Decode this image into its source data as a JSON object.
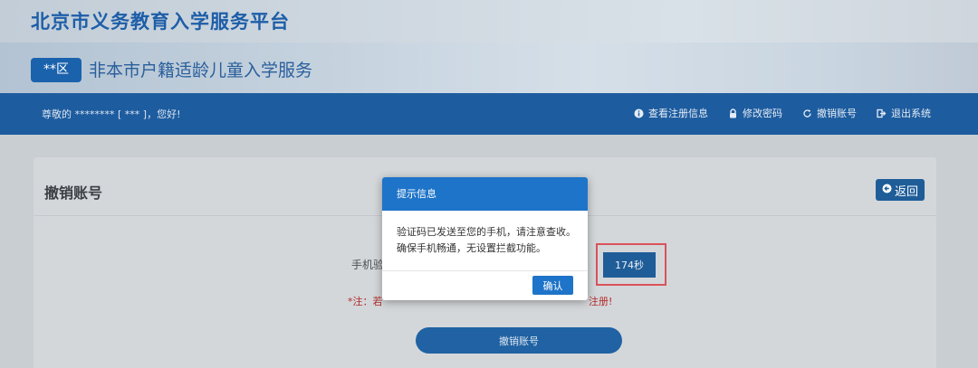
{
  "platform": {
    "title": "北京市义务教育入学服务平台"
  },
  "banner": {
    "district": "**区",
    "title": "非本市户籍适龄儿童入学服务"
  },
  "navbar": {
    "greeting": "尊敬的 ******** [ *** ]，您好!",
    "links": [
      {
        "label": "查看注册信息",
        "icon": "info-icon"
      },
      {
        "label": "修改密码",
        "icon": "lock-icon"
      },
      {
        "label": "撤销账号",
        "icon": "refresh-icon"
      },
      {
        "label": "退出系统",
        "icon": "logout-icon"
      }
    ]
  },
  "page": {
    "title": "撤销账号",
    "back_label": "返回",
    "phone_label": "手机验",
    "countdown": "174秒",
    "warning_prefix": "*注：若",
    "warning_suffix": "注册!",
    "cancel_button": "撤销账号"
  },
  "modal": {
    "title": "提示信息",
    "line1": "验证码已发送至您的手机，请注意查收。",
    "line2": "确保手机畅通，无设置拦截功能。",
    "confirm": "确认"
  },
  "colors": {
    "brand_blue": "#1e74c8",
    "nav_blue": "#1d5c9f",
    "warning_red": "#b22b2b"
  }
}
